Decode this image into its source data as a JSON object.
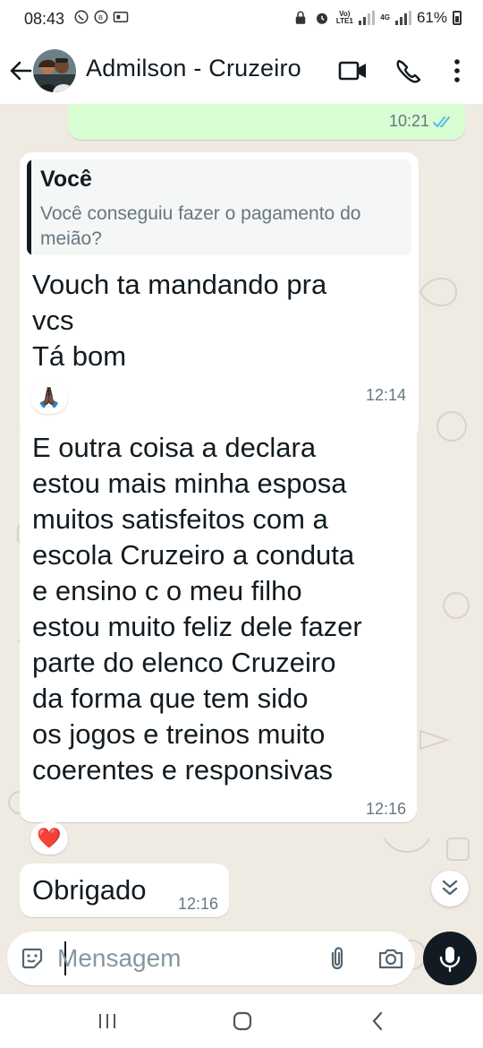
{
  "status_bar": {
    "time": "08:43",
    "network_label": "Vo) LTE1",
    "network_type": "4G",
    "battery": "61%"
  },
  "header": {
    "contact_name": "Admilson - Cruzeiro",
    "icons": [
      "arrow-back-icon",
      "video-call-icon",
      "phone-icon",
      "more-vert-icon"
    ]
  },
  "messages": [
    {
      "direction": "outgoing",
      "time": "10:21",
      "status": "read"
    },
    {
      "direction": "incoming",
      "quote": {
        "author": "Você",
        "text": "Você conseguiu fazer o pagamento do meião?"
      },
      "text": "Vouch ta mandando pra\nvcs\nTá bom",
      "time": "12:14",
      "reaction": "🙏🏿"
    },
    {
      "direction": "incoming",
      "text": "E outra coisa a declara\nestou mais minha esposa\nmuitos satisfeitos com a\nescola Cruzeiro a conduta\ne ensino c o meu filho\nestou muito feliz dele fazer\nparte do elenco Cruzeiro\nda forma que tem sido\nos jogos e treinos muito\ncoerentes e responsivas",
      "time": "12:16",
      "reaction": "❤️"
    },
    {
      "direction": "incoming",
      "text": "Obrigado",
      "time": "12:16"
    }
  ],
  "composer": {
    "placeholder": "Mensagem"
  },
  "colors": {
    "chat_background": "#efeae2",
    "outgoing_bubble": "#d9fdd3",
    "incoming_bubble": "#ffffff",
    "read_ticks": "#53bdeb",
    "mic_button": "#111b21"
  }
}
